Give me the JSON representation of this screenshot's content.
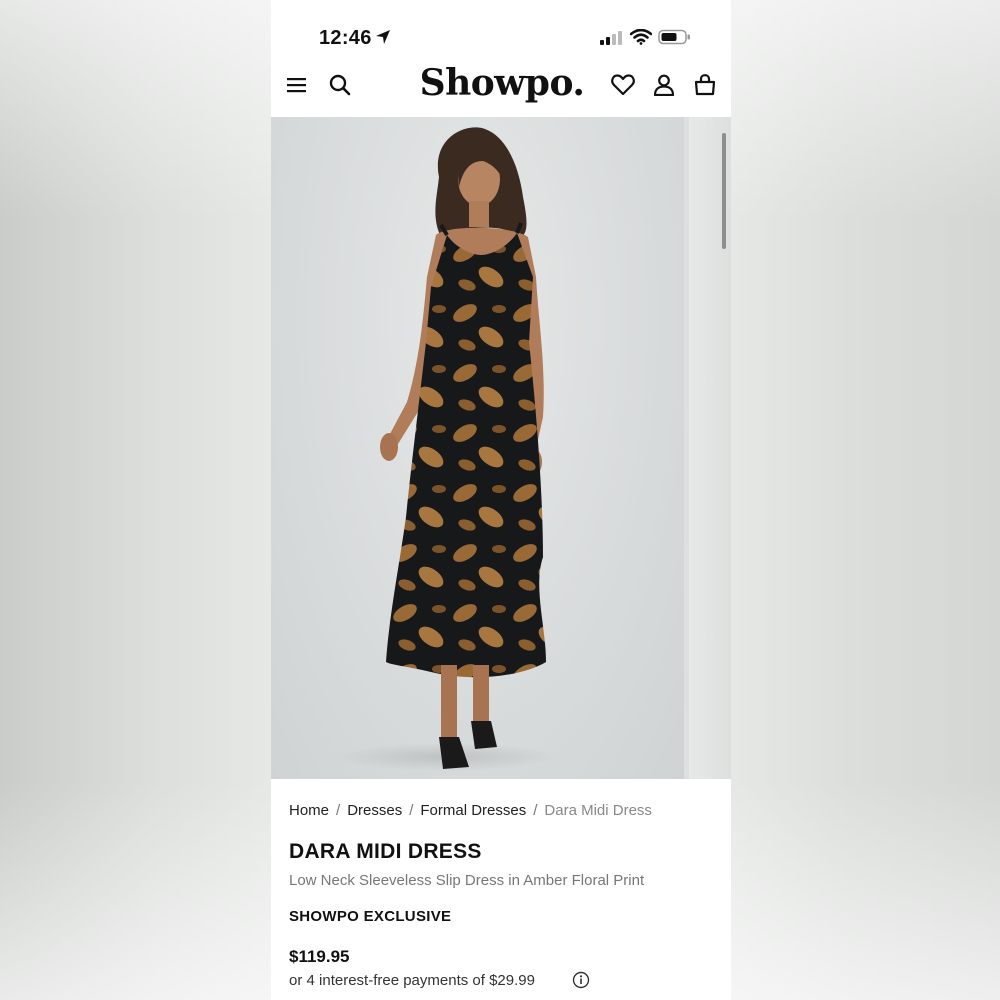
{
  "status_bar": {
    "time": "12:46",
    "icons": [
      "location-arrow-icon",
      "cellular-signal-icon",
      "wifi-icon",
      "battery-icon"
    ]
  },
  "header": {
    "logo": "Showpo.",
    "icons": [
      "menu-icon",
      "search-icon",
      "heart-icon",
      "account-icon",
      "bag-icon"
    ]
  },
  "gallery": {
    "image_description_alt": "Model wearing black and amber floral midi slip dress"
  },
  "breadcrumb": {
    "items": [
      "Home",
      "Dresses",
      "Formal Dresses",
      "Dara Midi Dress"
    ],
    "separator": "/"
  },
  "product": {
    "title": "DARA MIDI DRESS",
    "subtitle": "Low Neck Sleeveless Slip Dress in Amber Floral Print",
    "badge": "SHOWPO EXCLUSIVE",
    "price": "$119.95",
    "installments": "or 4 interest-free payments of $29.99"
  },
  "colors": {
    "text": "#111111",
    "muted": "#777777",
    "dress_black": "#16181a",
    "dress_amber": "#9a6a36"
  }
}
